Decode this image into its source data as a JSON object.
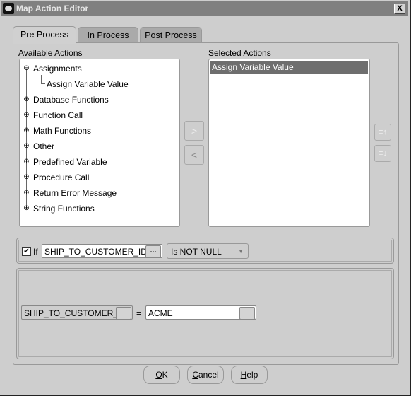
{
  "window": {
    "title": "Map Action Editor",
    "close_glyph": "X"
  },
  "tabs": [
    {
      "label": "Pre Process",
      "active": true
    },
    {
      "label": "In Process",
      "active": false
    },
    {
      "label": "Post Process",
      "active": false
    }
  ],
  "available": {
    "label": "Available Actions",
    "tree": [
      {
        "label": "Assignments",
        "expanded": true,
        "children": [
          "Assign Variable Value"
        ]
      },
      {
        "label": "Database Functions",
        "expanded": false
      },
      {
        "label": "Function Call",
        "expanded": false
      },
      {
        "label": "Math Functions",
        "expanded": false
      },
      {
        "label": "Other",
        "expanded": false
      },
      {
        "label": "Predefined Variable",
        "expanded": false
      },
      {
        "label": "Procedure Call",
        "expanded": false
      },
      {
        "label": "Return Error Message",
        "expanded": false
      },
      {
        "label": "String Functions",
        "expanded": false
      }
    ]
  },
  "transfer": {
    "add_glyph": ">",
    "remove_glyph": "<"
  },
  "selected": {
    "label": "Selected Actions",
    "items": [
      "Assign Variable Value"
    ],
    "move_up_glyph": "≡↑",
    "move_down_glyph": "≡↓"
  },
  "condition": {
    "checked": true,
    "if_label": "If",
    "field_value": "SHIP_TO_CUSTOMER_ID",
    "ellipsis": "···",
    "operator": "Is NOT NULL"
  },
  "assignment": {
    "target_value": "SHIP_TO_CUSTOMER_",
    "equals": "=",
    "source_value": "ACME",
    "ellipsis": "···"
  },
  "buttons": {
    "ok": {
      "mnemonic": "O",
      "rest": "K"
    },
    "cancel": {
      "mnemonic": "C",
      "rest": "ancel"
    },
    "help": {
      "mnemonic": "H",
      "rest": "elp"
    }
  }
}
